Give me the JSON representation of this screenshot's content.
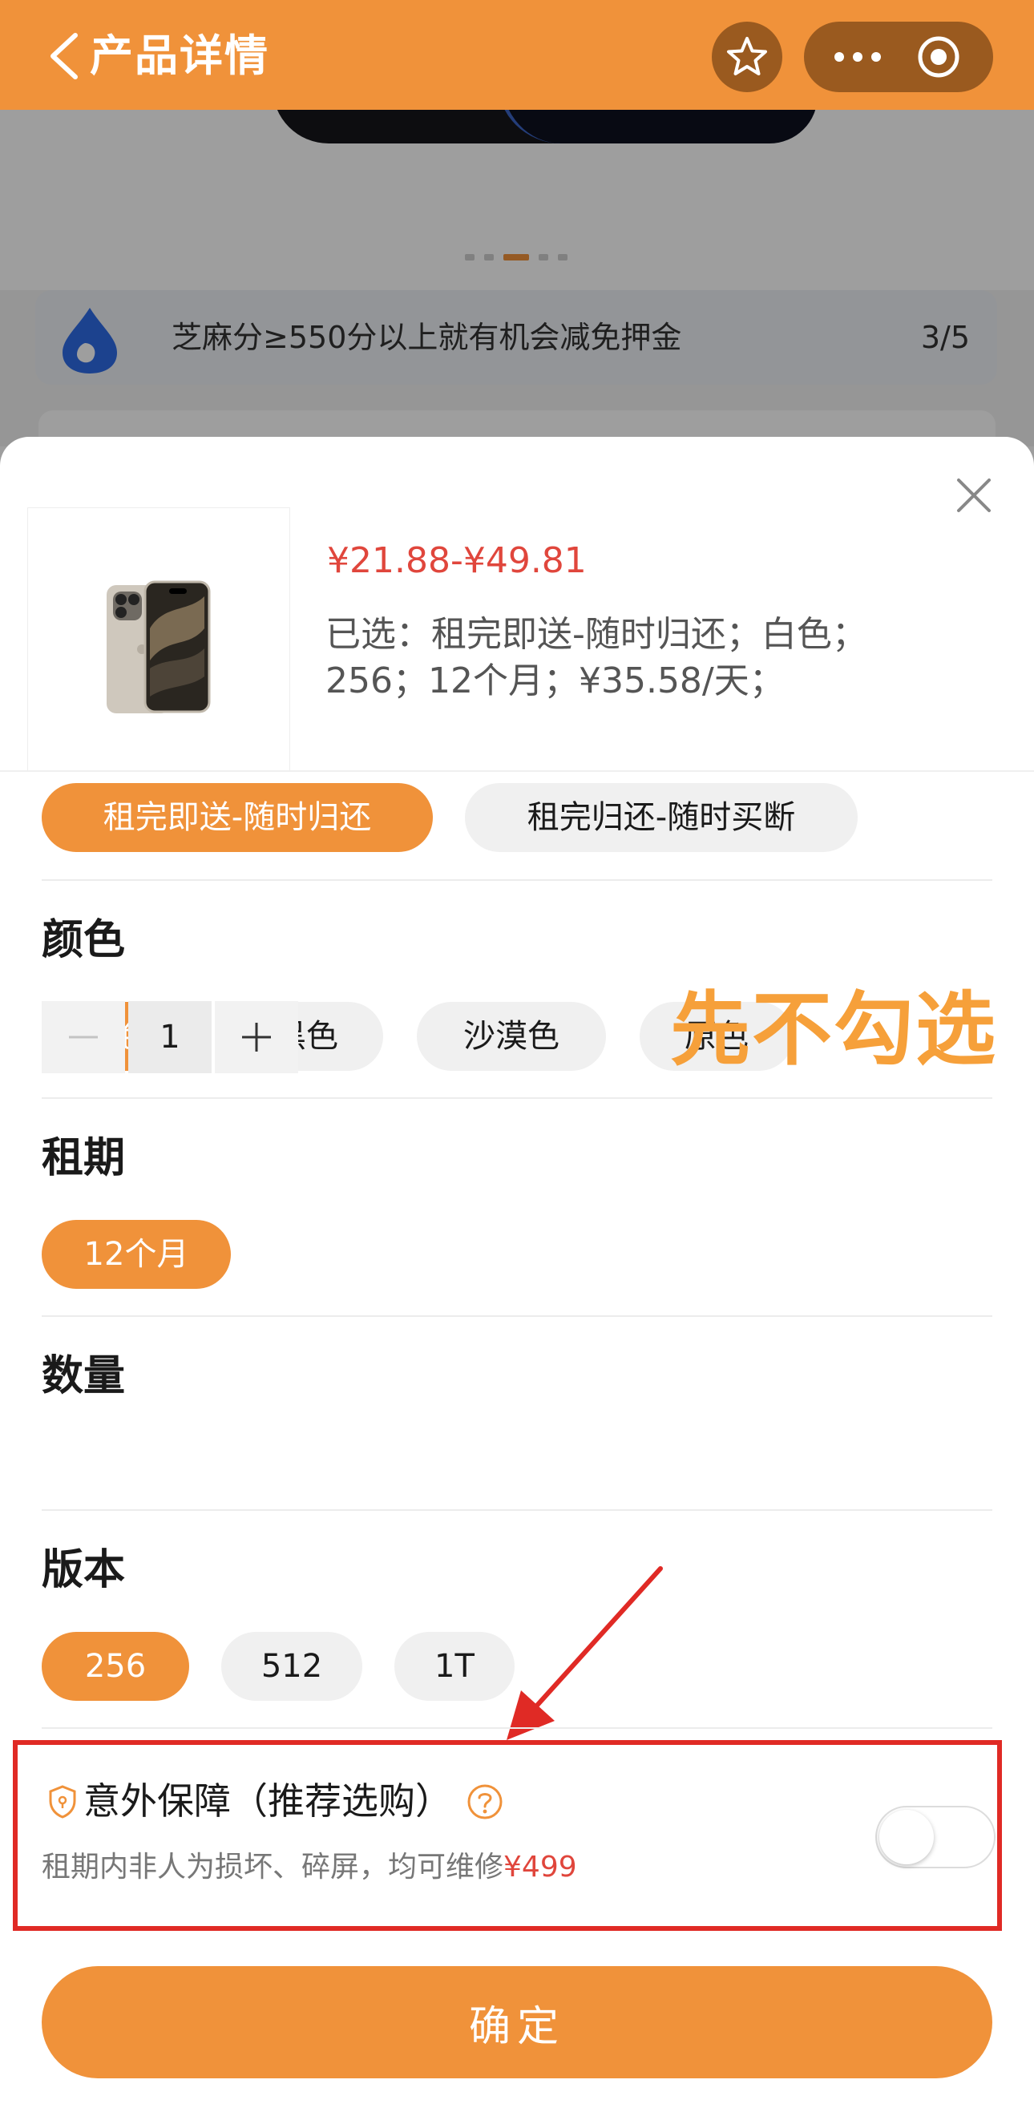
{
  "nav": {
    "title": "产品详情"
  },
  "zhima": {
    "text": "芝麻分≥550分以上就有机会减免押金",
    "counter": "3/5"
  },
  "product": {
    "price_range": "¥21.88-¥49.81",
    "selected_summary": "已选：租完即送-随时归还；白色；256；12个月；¥35.58/天；"
  },
  "plan": {
    "options": [
      "租完即送-随时归还",
      "租完归还-随时买断"
    ],
    "selected": "租完即送-随时归还"
  },
  "color": {
    "title": "颜色",
    "options": [
      "白色",
      "黑色",
      "沙漠色",
      "原色"
    ],
    "selected": "白色"
  },
  "term": {
    "title": "租期",
    "options": [
      "12个月"
    ],
    "selected": "12个月"
  },
  "quantity": {
    "title": "数量",
    "value": "1",
    "minus_icon": "minus-icon",
    "plus_icon": "plus-icon"
  },
  "version": {
    "title": "版本",
    "options": [
      "256",
      "512",
      "1T"
    ],
    "selected": "256"
  },
  "insurance": {
    "title": "意外保障（推荐选购）",
    "desc": "租期内非人为损坏、碎屏，均可维修",
    "price": "¥499",
    "enabled": false
  },
  "annotation": {
    "text": "先不勾选",
    "color": "#F6A03A",
    "box_color": "#E02A25"
  },
  "confirm": {
    "label": "确定"
  },
  "colors": {
    "brand": "#F0923A",
    "price": "#E0463C"
  }
}
